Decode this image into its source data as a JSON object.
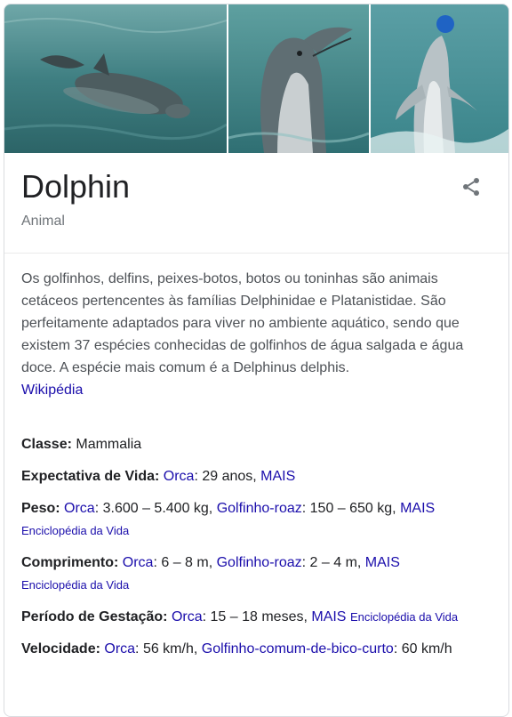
{
  "entity": {
    "title": "Dolphin",
    "subtitle": "Animal",
    "share_icon": "share-icon"
  },
  "images": [
    {
      "icon": "dolphin-swimming-photo"
    },
    {
      "icon": "dolphin-head-photo"
    },
    {
      "icon": "dolphin-ball-photo"
    }
  ],
  "description": {
    "text": "Os golfinhos, delfins, peixes-botos, botos ou toninhas são animais cetáceos pertencentes às famílias Delphinidae e Platanistidae. São perfeitamente adaptados para viver no ambiente aquático, sendo que existem 37 espécies conhecidas de golfinhos de água salgada e água doce. A espécie mais comum é a Delphinus delphis.",
    "source": "Wikipédia"
  },
  "facts": {
    "classe": {
      "label": "Classe:",
      "value": "Mammalia"
    },
    "expectativa": {
      "label": "Expectativa de Vida:",
      "link1": "Orca",
      "text1": ": 29 anos, ",
      "more": "MAIS"
    },
    "peso": {
      "label": "Peso:",
      "link1": "Orca",
      "text1": ": 3.600 – 5.400 kg, ",
      "link2": "Golfinho-roaz",
      "text2": ": 150 – 650 kg, ",
      "more": "MAIS",
      "source": "Enciclopédia da Vida"
    },
    "comprimento": {
      "label": "Comprimento:",
      "link1": "Orca",
      "text1": ": 6 – 8 m, ",
      "link2": "Golfinho-roaz",
      "text2": ": 2 – 4 m, ",
      "more": "MAIS",
      "source": "Enciclopédia da Vida"
    },
    "gestacao": {
      "label": "Período de Gestação:",
      "link1": "Orca",
      "text1": ": 15 – 18 meses, ",
      "more": "MAIS",
      "source": "Enciclopédia da Vida"
    },
    "velocidade": {
      "label": "Velocidade:",
      "link1": "Orca",
      "text1": ": 56 km/h, ",
      "link2": "Golfinho-comum-de-bico-curto",
      "text2": ": 60 km/h"
    }
  },
  "colors": {
    "link": "#1a0dab",
    "text": "#202124",
    "muted": "#70757a",
    "water": "#3f8a8e"
  }
}
